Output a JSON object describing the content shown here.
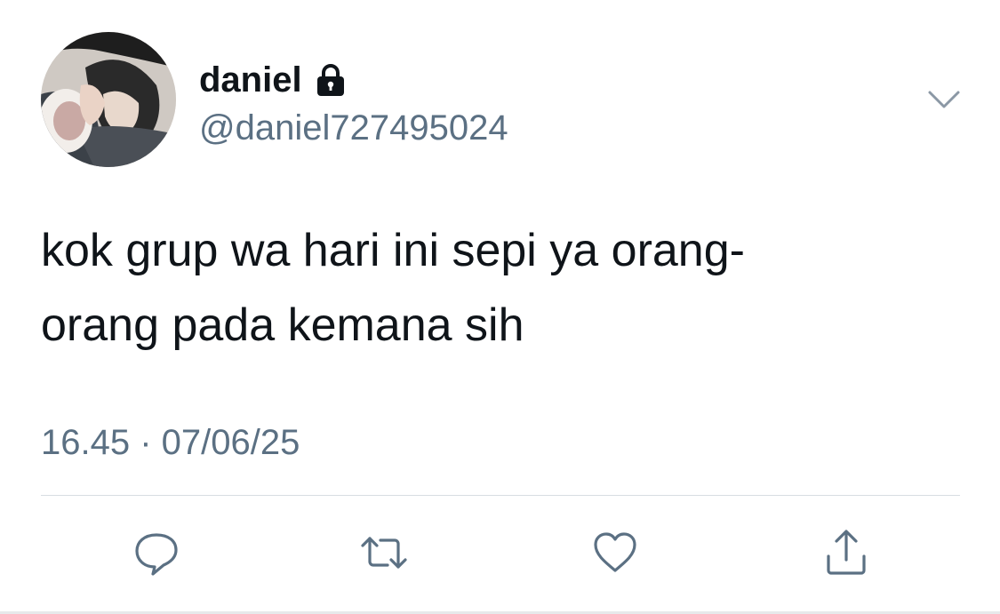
{
  "tweet": {
    "author": {
      "display_name": "daniel",
      "handle": "@daniel727495024",
      "protected_icon": "lock-icon",
      "avatar": "profile-photo"
    },
    "text_lines": [
      "kok grup wa hari ini sepi ya orang-",
      "orang pada kemana sih"
    ],
    "timestamp": "16.45 · 07/06/25",
    "menu_icon": "chevron-down-icon",
    "actions": [
      {
        "name": "reply",
        "icon": "speech-bubble-icon"
      },
      {
        "name": "retweet",
        "icon": "retweet-arrows-icon"
      },
      {
        "name": "like",
        "icon": "heart-icon"
      },
      {
        "name": "share",
        "icon": "share-upload-icon"
      }
    ]
  },
  "colors": {
    "text_primary": "#0f1419",
    "text_secondary": "#5b7083",
    "divider": "#d7dde2"
  }
}
